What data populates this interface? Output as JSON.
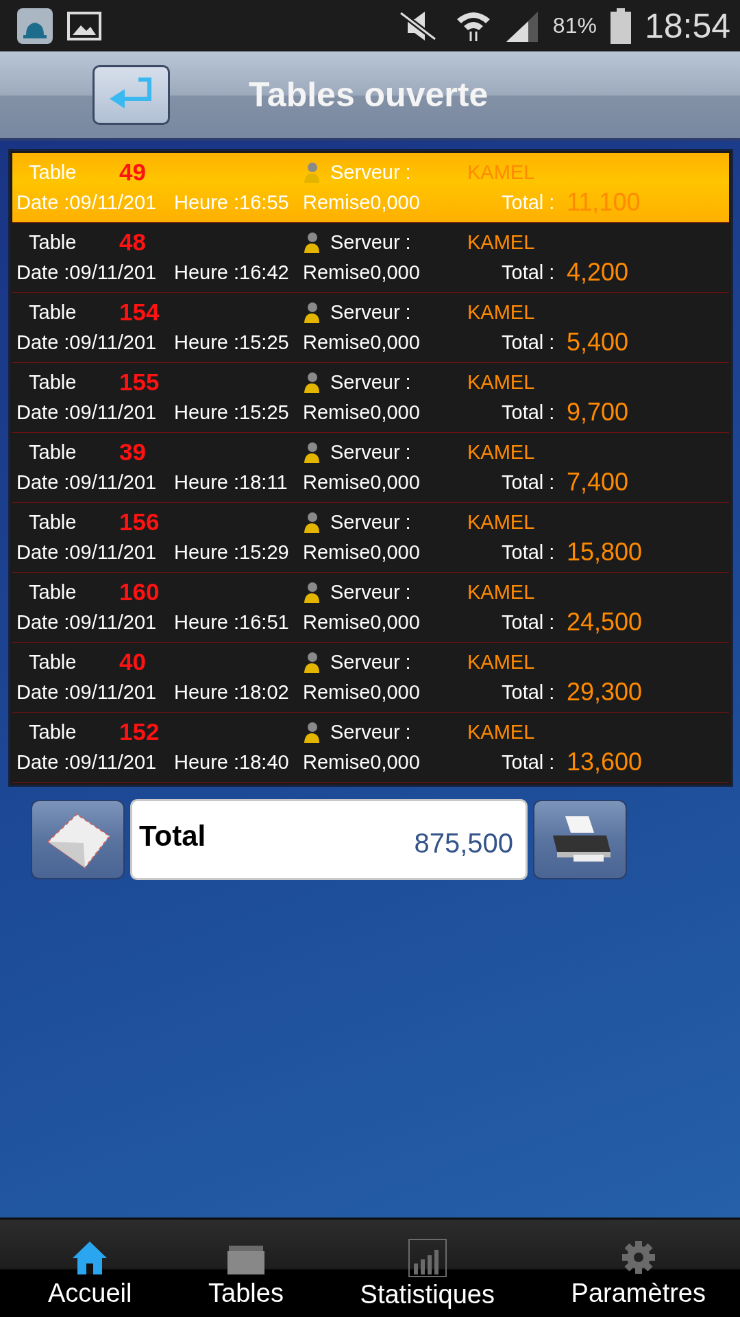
{
  "status_bar": {
    "battery": "81%",
    "time": "18:54"
  },
  "header": {
    "title": "Tables ouverte"
  },
  "tables": [
    {
      "label": "Table",
      "number": "49",
      "server_label": "Serveur :",
      "server": "KAMEL",
      "date": "Date :09/11/201",
      "time": "Heure :16:55",
      "discount": "Remise0,000",
      "total_label": "Total :",
      "total": "11,100",
      "selected": true
    },
    {
      "label": "Table",
      "number": "48",
      "server_label": "Serveur :",
      "server": "KAMEL",
      "date": "Date :09/11/201",
      "time": "Heure :16:42",
      "discount": "Remise0,000",
      "total_label": "Total :",
      "total": "4,200",
      "selected": false
    },
    {
      "label": "Table",
      "number": "154",
      "server_label": "Serveur :",
      "server": "KAMEL",
      "date": "Date :09/11/201",
      "time": "Heure :15:25",
      "discount": "Remise0,000",
      "total_label": "Total :",
      "total": "5,400",
      "selected": false
    },
    {
      "label": "Table",
      "number": "155",
      "server_label": "Serveur :",
      "server": "KAMEL",
      "date": "Date :09/11/201",
      "time": "Heure :15:25",
      "discount": "Remise0,000",
      "total_label": "Total :",
      "total": "9,700",
      "selected": false
    },
    {
      "label": "Table",
      "number": "39",
      "server_label": "Serveur :",
      "server": "KAMEL",
      "date": "Date :09/11/201",
      "time": "Heure :18:11",
      "discount": "Remise0,000",
      "total_label": "Total :",
      "total": "7,400",
      "selected": false
    },
    {
      "label": "Table",
      "number": "156",
      "server_label": "Serveur :",
      "server": "KAMEL",
      "date": "Date :09/11/201",
      "time": "Heure :15:29",
      "discount": "Remise0,000",
      "total_label": "Total :",
      "total": "15,800",
      "selected": false
    },
    {
      "label": "Table",
      "number": "160",
      "server_label": "Serveur :",
      "server": "KAMEL",
      "date": "Date :09/11/201",
      "time": "Heure :16:51",
      "discount": "Remise0,000",
      "total_label": "Total :",
      "total": "24,500",
      "selected": false
    },
    {
      "label": "Table",
      "number": "40",
      "server_label": "Serveur :",
      "server": "KAMEL",
      "date": "Date :09/11/201",
      "time": "Heure :18:02",
      "discount": "Remise0,000",
      "total_label": "Total :",
      "total": "29,300",
      "selected": false
    },
    {
      "label": "Table",
      "number": "152",
      "server_label": "Serveur :",
      "server": "KAMEL",
      "date": "Date :09/11/201",
      "time": "Heure :18:40",
      "discount": "Remise0,000",
      "total_label": "Total :",
      "total": "13,600",
      "selected": false
    }
  ],
  "summary": {
    "label": "Total",
    "value": "875,500"
  },
  "tabs": [
    {
      "label": "Accueil",
      "selected": true
    },
    {
      "label": "Tables",
      "selected": false
    },
    {
      "label": "Statistiques",
      "selected": false
    },
    {
      "label": "Paramètres",
      "selected": false
    }
  ]
}
